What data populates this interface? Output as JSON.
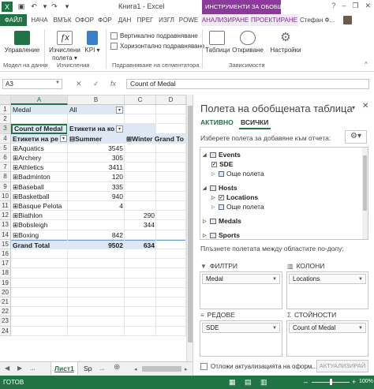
{
  "titlebar": {
    "title": "Книга1 - Excel",
    "context_title": "ИНСТРУМЕНТИ ЗА ОБОБЩЕНА Т...",
    "help": "?",
    "minimize": "–",
    "restore": "❐",
    "close": "✕"
  },
  "tabs": {
    "file": "ФАЙЛ",
    "home": "НАЧА",
    "insert": "ВМЪК",
    "page": "ОФОР",
    "formulas": "ФОР",
    "data": "ДАН",
    "review": "ПРЕГ",
    "view": "ИЗГЛ",
    "powerpivot": "POWE",
    "analyze": "АНАЛИЗИРАНЕ",
    "design": "ПРОЕКТИРАНЕ",
    "user": "Стефан Ф..."
  },
  "ribbon": {
    "manage_label": "Управление",
    "calc_fields_label": "Изчислени полета ▾",
    "kpi_label": "KPI ▾",
    "group1_label": "Модел на данни",
    "group2_label": "Изчисления",
    "vertical_label": "Вертикално подравняване",
    "horizontal_label": "Хоризонтално подравняване",
    "group3_label": "Подравняване на сегментатора",
    "tables_label": "Таблици",
    "detect_label": "Откриване",
    "settings_label": "Настройки",
    "group4_label": "Зависимости",
    "collapse": "^"
  },
  "formula_bar": {
    "name_box": "A3",
    "cancel": "✕",
    "enter": "✓",
    "fx": "fx",
    "value": "Count of Medal"
  },
  "grid": {
    "columns": [
      "A",
      "B",
      "C",
      "D"
    ],
    "rows": [
      {
        "n": "1",
        "a": "Medal",
        "b": "All",
        "c": "",
        "d": ""
      },
      {
        "n": "2",
        "a": "",
        "b": "",
        "c": "",
        "d": ""
      },
      {
        "n": "3",
        "a": "Count of Medal",
        "b": "Етикети на ко",
        "c": "",
        "d": ""
      },
      {
        "n": "4",
        "a": "Етикети на ре",
        "b": "⊟Summer",
        "c": "⊞Winter Grand To",
        "d": ""
      },
      {
        "n": "5",
        "a": "⊞Aquatics",
        "b": "3545",
        "c": "",
        "d": ""
      },
      {
        "n": "6",
        "a": "⊞Archery",
        "b": "305",
        "c": "",
        "d": ""
      },
      {
        "n": "7",
        "a": "⊞Athletics",
        "b": "3411",
        "c": "",
        "d": ""
      },
      {
        "n": "8",
        "a": "⊞Badminton",
        "b": "120",
        "c": "",
        "d": ""
      },
      {
        "n": "9",
        "a": "⊞Baseball",
        "b": "335",
        "c": "",
        "d": ""
      },
      {
        "n": "10",
        "a": "⊞Basketball",
        "b": "940",
        "c": "",
        "d": ""
      },
      {
        "n": "11",
        "a": "⊞Basque Pelota",
        "b": "4",
        "c": "",
        "d": ""
      },
      {
        "n": "12",
        "a": "⊞Biathlon",
        "b": "",
        "c": "290",
        "d": ""
      },
      {
        "n": "13",
        "a": "⊞Bobsleigh",
        "b": "",
        "c": "344",
        "d": ""
      },
      {
        "n": "14",
        "a": "⊞Boxing",
        "b": "842",
        "c": "",
        "d": ""
      },
      {
        "n": "15",
        "a": "Grand Total",
        "b": "9502",
        "c": "634",
        "d": ""
      },
      {
        "n": "16",
        "a": "",
        "b": "",
        "c": "",
        "d": ""
      },
      {
        "n": "17",
        "a": "",
        "b": "",
        "c": "",
        "d": ""
      },
      {
        "n": "18",
        "a": "",
        "b": "",
        "c": "",
        "d": ""
      },
      {
        "n": "19",
        "a": "",
        "b": "",
        "c": "",
        "d": ""
      },
      {
        "n": "20",
        "a": "",
        "b": "",
        "c": "",
        "d": ""
      },
      {
        "n": "21",
        "a": "",
        "b": "",
        "c": "",
        "d": ""
      },
      {
        "n": "22",
        "a": "",
        "b": "",
        "c": "",
        "d": ""
      },
      {
        "n": "23",
        "a": "",
        "b": "",
        "c": "",
        "d": ""
      },
      {
        "n": "24",
        "a": "",
        "b": "",
        "c": "",
        "d": ""
      }
    ]
  },
  "sheets": {
    "active": "Лист1",
    "other": "Sp",
    "more": "...",
    "add": "⊕"
  },
  "pane": {
    "title": "Полета на обобщената таблица",
    "tab_active": "АКТИВНО",
    "tab_all": "ВСИЧКИ",
    "choose_label": "Изберете полета за добавяне към отчета:",
    "fields": {
      "events": "Events",
      "sde": "SDE",
      "more1": "Още полета",
      "hosts": "Hosts",
      "locations": "Locations",
      "more2": "Още полета",
      "medals": "Medals",
      "sports": "Sports"
    },
    "drag_label": "Плъзнете полетата между областите по-долу:",
    "filters_title": "ФИЛТРИ",
    "columns_title": "КОЛОНИ",
    "rows_title": "РЕДОВЕ",
    "values_title": "СТОЙНОСТИ",
    "filters_field": "Medal",
    "columns_field": "Locations",
    "rows_field": "SDE",
    "values_field": "Count of Medal",
    "defer_label": "Отложи актуализацията на оформ...",
    "update_button": "АКТУАЛИЗИРАЙ"
  },
  "status": {
    "ready": "ГОТОВ",
    "zoom_minus": "–",
    "zoom_plus": "+",
    "zoom": "100%"
  },
  "colors": {
    "excel_green": "#217346",
    "context_purple": "#8b3a9c"
  }
}
